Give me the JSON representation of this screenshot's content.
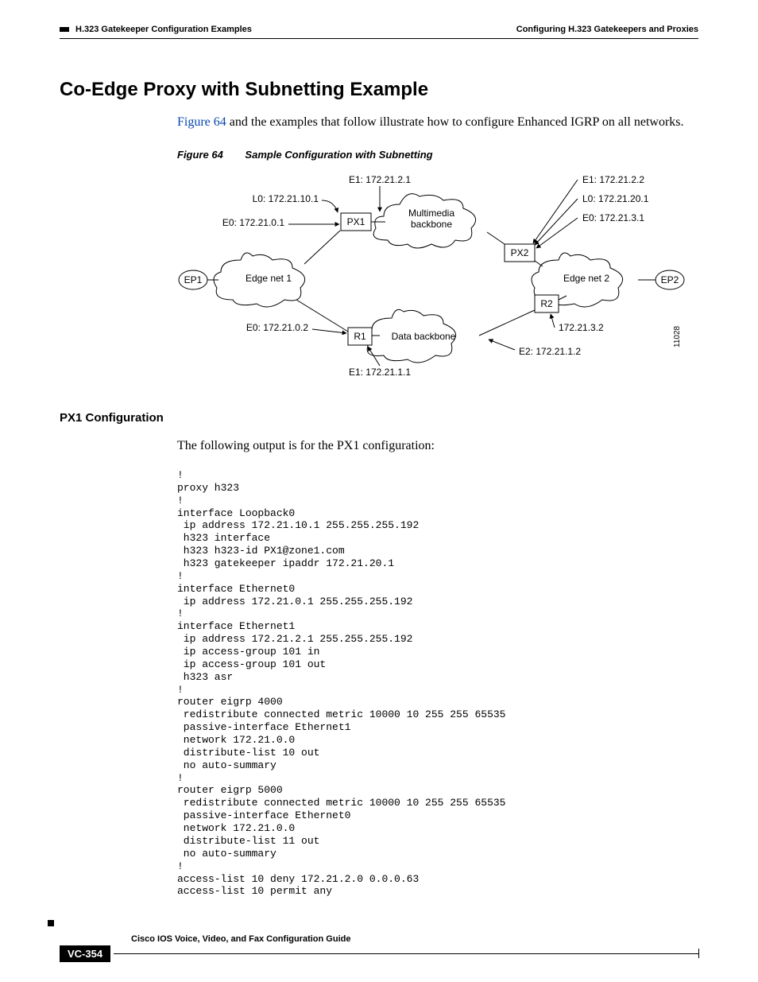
{
  "header": {
    "left": "H.323 Gatekeeper Configuration Examples",
    "right": "Configuring H.323 Gatekeepers and Proxies"
  },
  "title": "Co-Edge Proxy with Subnetting Example",
  "lead": {
    "link": "Figure 64",
    "rest": " and the examples that follow illustrate how to configure Enhanced IGRP on all networks."
  },
  "figure": {
    "label": "Figure 64",
    "caption": "Sample Configuration with Subnetting",
    "labels": {
      "e1_left": "E1:  172.21.2.1",
      "l0_left": "L0:  172.21.10.1",
      "e0_left": "E0:  172.21.0.1",
      "px1": "PX1",
      "mm": "Multimedia\nbackbone",
      "px2": "PX2",
      "e1_right": "E1:  172.21.2.2",
      "l0_right": "L0:  172.21.20.1",
      "e0_right": "E0:  172.21.3.1",
      "ep1": "EP1",
      "edge1": "Edge net 1",
      "edge2": "Edge net 2",
      "ep2": "EP2",
      "r1": "R1",
      "r2": "R2",
      "data": "Data backbone",
      "e0_r1": "E0:  172.21.0.2",
      "e1_r1": "E1:  172.21.1.1",
      "ip_r2": "172.21.3.2",
      "e2_r2": "E2:  172.21.1.2",
      "id": "11028"
    }
  },
  "subheading": "PX1 Configuration",
  "intro": "The following output is for the PX1 configuration:",
  "code": "!\nproxy h323\n!\ninterface Loopback0\n ip address 172.21.10.1 255.255.255.192\n h323 interface\n h323 h323-id PX1@zone1.com\n h323 gatekeeper ipaddr 172.21.20.1\n!\ninterface Ethernet0\n ip address 172.21.0.1 255.255.255.192\n!\ninterface Ethernet1\n ip address 172.21.2.1 255.255.255.192\n ip access-group 101 in\n ip access-group 101 out\n h323 asr\n!\nrouter eigrp 4000\n redistribute connected metric 10000 10 255 255 65535\n passive-interface Ethernet1\n network 172.21.0.0\n distribute-list 10 out\n no auto-summary\n!\nrouter eigrp 5000\n redistribute connected metric 10000 10 255 255 65535\n passive-interface Ethernet0\n network 172.21.0.0\n distribute-list 11 out\n no auto-summary\n!\naccess-list 10 deny 172.21.2.0 0.0.0.63\naccess-list 10 permit any",
  "footer": {
    "guide": "Cisco IOS Voice, Video, and Fax Configuration Guide",
    "page": "VC-354"
  }
}
